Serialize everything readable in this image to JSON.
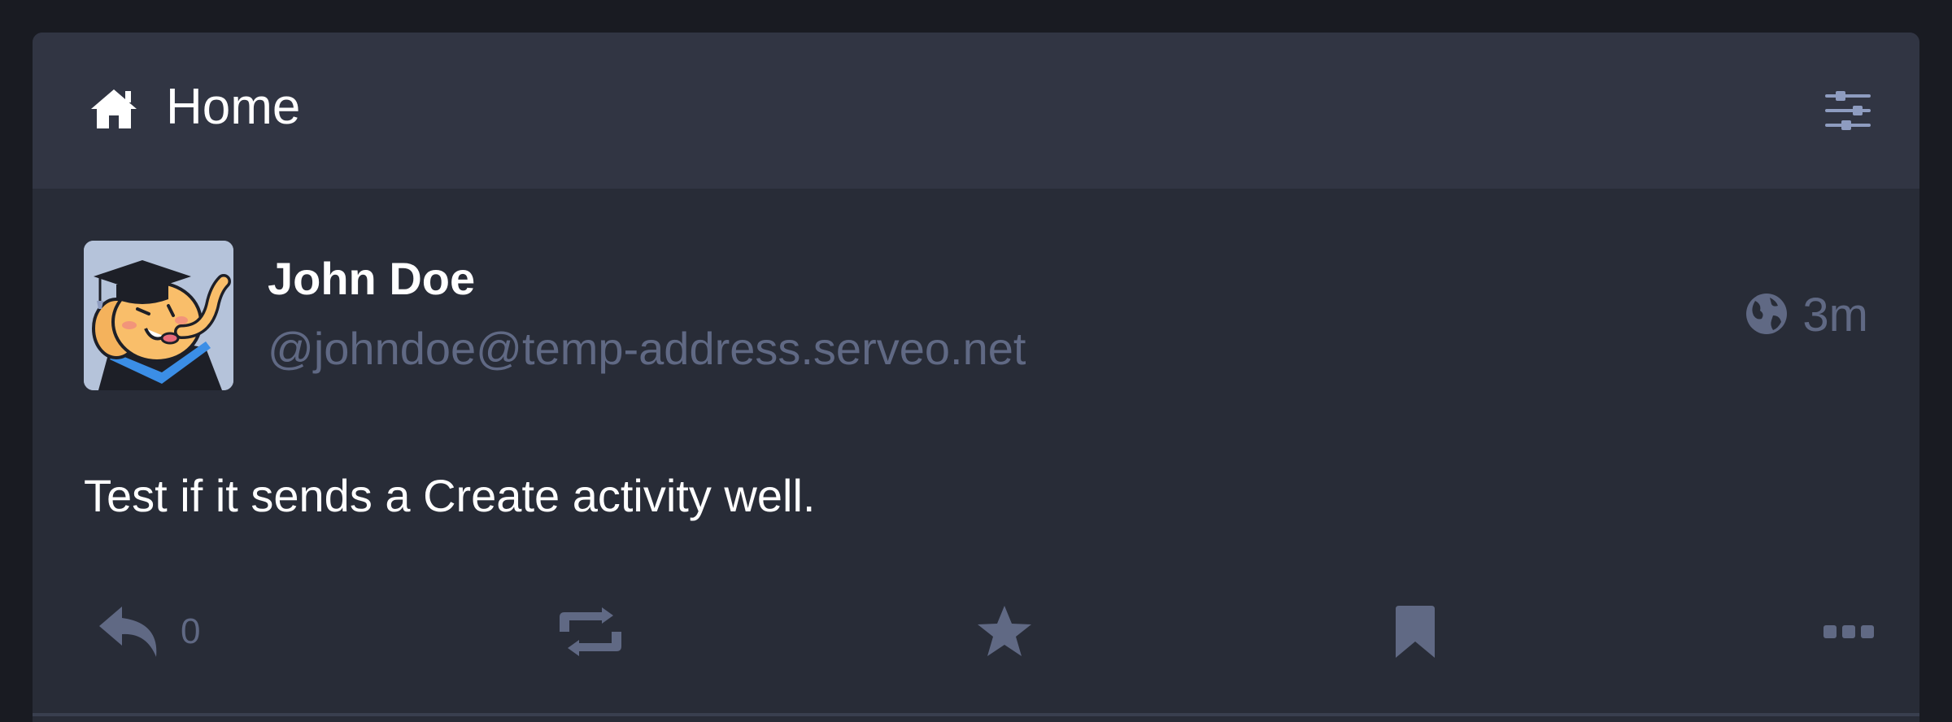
{
  "header": {
    "title": "Home",
    "icon": "home-icon",
    "settings_icon": "sliders-icon"
  },
  "status": {
    "display_name": "John Doe",
    "account": "@johndoe@temp-address.serveo.net",
    "visibility_icon": "globe-icon",
    "timestamp": "3m",
    "content": "Test if it sends a Create activity well.",
    "avatar_icon": "mastodon-elephant-graduate-avatar",
    "actions": {
      "reply_icon": "reply-icon",
      "reply_count": "0",
      "boost_icon": "boost-icon",
      "favourite_icon": "star-icon",
      "bookmark_icon": "bookmark-icon",
      "more_icon": "more-icon"
    }
  },
  "colors": {
    "background": "#191b22",
    "header_bg": "#313543",
    "status_bg": "#282c37",
    "muted_text": "#606984",
    "icon_gray": "#606984",
    "settings_icon": "#8e9cc0",
    "text": "#ffffff"
  }
}
